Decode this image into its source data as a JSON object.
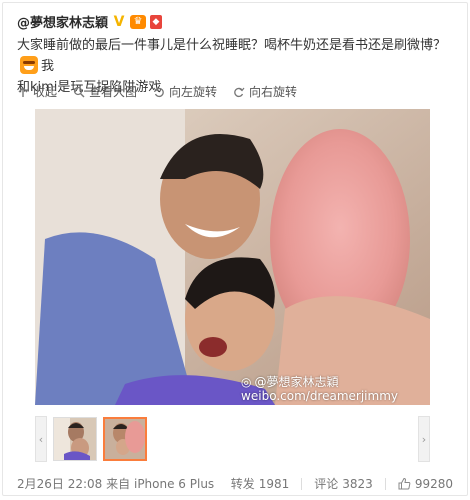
{
  "post": {
    "author": "@夢想家林志穎",
    "text_line1": "大家睡前做的最后一件事儿是什么祝睡眠？喝杯牛奶还是看书还是刷微博？",
    "text_line1_tail": "我",
    "text_line2": "和kimi是玩互捉陷阱游戏"
  },
  "toolbar": {
    "collapse": "收起",
    "view_large": "查看大图",
    "rotate_left": "向左旋转",
    "rotate_right": "向右旋转"
  },
  "photo": {
    "watermark_name": "@夢想家林志穎",
    "watermark_url": "weibo.com/dreamerjimmy"
  },
  "thumbnails": {
    "prev": "‹",
    "next": "›"
  },
  "footer": {
    "date": "2月26日 22:08",
    "source_prefix": "来自",
    "source": "iPhone 6 Plus",
    "repost_label": "转发",
    "repost_count": "1981",
    "comment_label": "评论",
    "comment_count": "3823",
    "like_count": "99280"
  },
  "colors": {
    "accent": "#fa7d3c",
    "verified": "#f5b400"
  },
  "icons": [
    "collapse-icon",
    "search-icon",
    "rotate-left-icon",
    "rotate-right-icon",
    "like-icon"
  ]
}
